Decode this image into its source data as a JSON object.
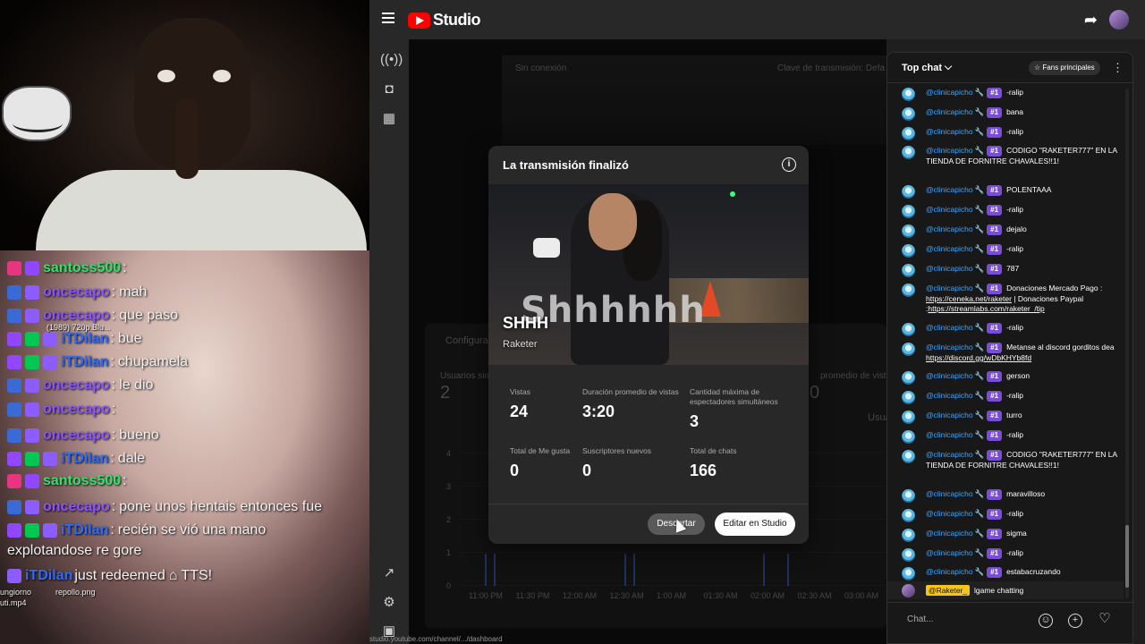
{
  "overlay_chat": {
    "lines": [
      {
        "user": "santoss500",
        "text": ""
      },
      {
        "user": "oncecapo",
        "text": "mah"
      },
      {
        "user": "oncecapo",
        "text": "que paso"
      },
      {
        "user": "iTDilan",
        "text": "bue"
      },
      {
        "user": "iTDilan",
        "text": "chupamela"
      },
      {
        "user": "oncecapo",
        "text": "le dio"
      },
      {
        "user": "oncecapo",
        "text": ""
      },
      {
        "user": "oncecapo",
        "text": "bueno"
      },
      {
        "user": "iTDilan",
        "text": "dale"
      },
      {
        "user": "santoss500",
        "text": ""
      },
      {
        "user": "oncecapo",
        "text": "pone unos hentais entonces fue"
      },
      {
        "user": "iTDilan",
        "text": "recién se vió una mano"
      }
    ],
    "continuation": "explotandose re gore",
    "redeem": {
      "user": "iTDilan",
      "text": "just redeemed",
      "reward": "TTS!"
    },
    "file_labels": [
      "(1989) 720p.Blu...",
      "repollo.png",
      "ungiorno",
      "uti.mp4"
    ]
  },
  "studio": {
    "logo_text": "Studio",
    "preview_status": "Sin conexión",
    "preview_key_label": "Clave de transmisión: Defa",
    "tab_config": "Configurac",
    "metric_left_label": "Usuarios simul",
    "metric_left_value": "2",
    "metric_right_label": "promedio de vistas",
    "metric_right_value": "0",
    "metric_right_tab": "Usua",
    "y_ticks": [
      "4",
      "3",
      "2",
      "1",
      "0"
    ],
    "x_ticks": [
      "11:00 PM",
      "11:30 PM",
      "12:00 AM",
      "12:30 AM",
      "1:00 AM",
      "01:30 AM",
      "02:00 AM",
      "02:30 AM",
      "03:00 AM",
      "03:3"
    ],
    "status_url": "studio.youtube.com/channel/.../dashboard"
  },
  "modal": {
    "title": "La transmisión finalizó",
    "overlay_text": "Shhhhhh",
    "video_title": "SHHH",
    "channel": "Raketer",
    "stats": [
      {
        "label": "Vistas",
        "value": "24"
      },
      {
        "label": "Duración promedio de vistas",
        "value": "3:20"
      },
      {
        "label": "Cantidad máxima de espectadores simultáneos",
        "value": "3"
      },
      {
        "label": "Total de Me gusta",
        "value": "0"
      },
      {
        "label": "Suscriptores nuevos",
        "value": "0"
      },
      {
        "label": "Total de chats",
        "value": "166"
      }
    ],
    "discard_label": "Descartar",
    "edit_label": "Editar en Studio"
  },
  "live_chat": {
    "header": "Top chat",
    "fans_label": "Fans principales",
    "badge": "#1",
    "messages": [
      {
        "user": "@clinicapicho",
        "text": "-ralip"
      },
      {
        "user": "@clinicapicho",
        "text": "bana"
      },
      {
        "user": "@clinicapicho",
        "text": "-ralip"
      },
      {
        "user": "@clinicapicho",
        "text": "CODIGO \"RAKETER777\" EN LA TIENDA DE FORNITRE CHAVALES!!1!"
      },
      {
        "user": "@clinicapicho",
        "text": "POLENTAAA"
      },
      {
        "user": "@clinicapicho",
        "text": "-ralip"
      },
      {
        "user": "@clinicapicho",
        "text": "dejalo"
      },
      {
        "user": "@clinicapicho",
        "text": "-ralip"
      },
      {
        "user": "@clinicapicho",
        "text": "787"
      },
      {
        "user": "@clinicapicho",
        "text": "Donaciones Mercado Pago : ",
        "link": "https://ceneka.net/raketer",
        "text2": " | Donaciones Paypal :",
        "link2": "https://streamlabs.com/raketer_/tip"
      },
      {
        "user": "@clinicapicho",
        "text": "-ralip"
      },
      {
        "user": "@clinicapicho",
        "text": "Metanse al discord gorditos dea ",
        "link": "https://discord.gg/wDbKHYb8fd"
      },
      {
        "user": "@clinicapicho",
        "text": "gerson"
      },
      {
        "user": "@clinicapicho",
        "text": "-ralip"
      },
      {
        "user": "@clinicapicho",
        "text": "turro"
      },
      {
        "user": "@clinicapicho",
        "text": "-ralip"
      },
      {
        "user": "@clinicapicho",
        "text": "CODIGO \"RAKETER777\" EN LA TIENDA DE FORNITRE CHAVALES!!1!"
      },
      {
        "user": "@clinicapicho",
        "text": "maravilloso"
      },
      {
        "user": "@clinicapicho",
        "text": "-ralip"
      },
      {
        "user": "@clinicapicho",
        "text": "sigma"
      },
      {
        "user": "@clinicapicho",
        "text": "-ralip"
      },
      {
        "user": "@clinicapicho",
        "text": "estabacruzando"
      }
    ],
    "own_message": {
      "user": "@Raketer_",
      "text": "lgame chatting"
    },
    "input_placeholder": "Chat..."
  },
  "colors": {
    "accent_blue": "#3ea6ff",
    "yt_red": "#ff0000",
    "member_purple": "#7a4dd8",
    "owner_yellow": "#f5c518"
  }
}
